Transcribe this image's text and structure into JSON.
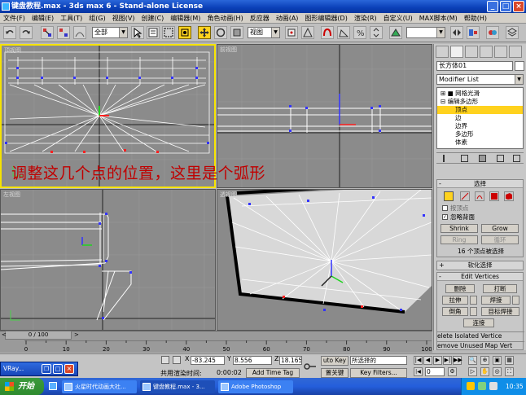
{
  "window": {
    "title": "键盘教程.max - 3ds max 6 - Stand-alone License",
    "min": "_",
    "max": "□",
    "close": "×"
  },
  "menu": [
    "文件(F)",
    "编辑(E)",
    "工具(T)",
    "组(G)",
    "视图(V)",
    "创建(C)",
    "编辑器(M)",
    "角色动画(H)",
    "反应器",
    "动画(A)",
    "图形编辑器(D)",
    "渲染(R)",
    "自定义(U)",
    "MAX脚本(M)",
    "帮助(H)"
  ],
  "toolbar": {
    "selection_filter": "全部",
    "ref_coord": "视图",
    "named_set": ""
  },
  "viewports": {
    "top": "顶视图",
    "front": "前视图",
    "left": "左视图",
    "perspective": "透视图"
  },
  "annotation": "调整这几个点的位置，这里是个弧形",
  "command_panel": {
    "object_name": "长方体01",
    "modifier_list": "Modifier List",
    "stack": [
      "网格光滑",
      "编辑多边形",
      "顶点",
      "边",
      "边界",
      "多边形",
      "体素"
    ],
    "stack_selected": "顶点",
    "selection": {
      "title": "选择",
      "by_vertex": "按顶点",
      "ignore_backface": "忽略背面",
      "shrink": "Shrink",
      "grow": "Grow",
      "ring": "Ring",
      "loop": "循环",
      "status": "16 个顶点被选择"
    },
    "soft_selection": {
      "title": "软化选择"
    },
    "edit_vertices": {
      "title": "Edit Vertices",
      "remove": "删除",
      "break": "打断",
      "extrude": "拉伸",
      "weld": "焊接",
      "chamfer": "倒角",
      "target_weld": "目标焊接",
      "connect": "连接",
      "remove_isolated": "elete Isolated Vertice",
      "remove_unused": "emove Unused Map Vert"
    }
  },
  "timeline": {
    "slider": "0 / 100",
    "ticks": [
      "0",
      "10",
      "20",
      "30",
      "40",
      "50",
      "60",
      "70",
      "80",
      "90",
      "100"
    ]
  },
  "statusbar": {
    "x": "-83.245",
    "y": "8.556",
    "z": "18.165",
    "x_label": "X",
    "y_label": "Y",
    "z_label": "Z",
    "prompt": "共用渲染时间:",
    "time": "0:00:02",
    "add_time_tag": "Add Time Tag",
    "auto_key": "uto Key",
    "key_mode": "所选择的",
    "set_key": "置关键",
    "key_filters": "Key Filters...",
    "frame": "0"
  },
  "vray_window": "VRay...",
  "taskbar": {
    "start": "开始",
    "tasks": [
      "火星时代动画大社...",
      "键盘教程.max - 3...",
      "Adobe Photoshop"
    ],
    "clock": "10:35"
  }
}
